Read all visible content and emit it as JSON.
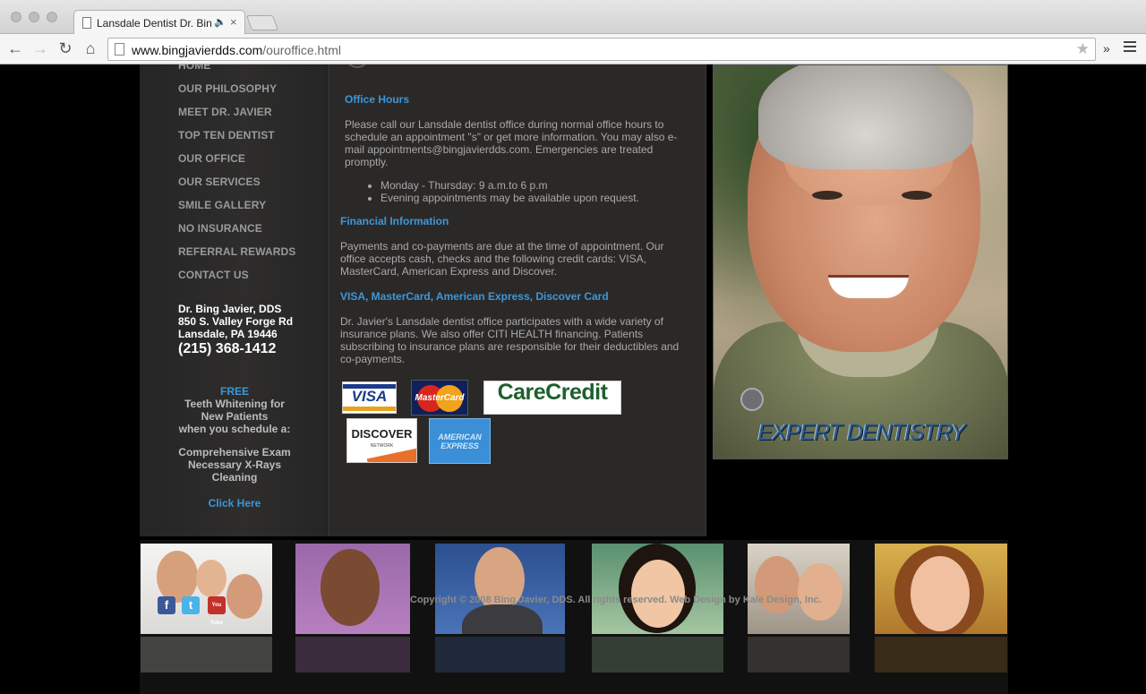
{
  "browser": {
    "tab_title": "Lansdale Dentist Dr. Bin",
    "url_host": "www.bingjavierdds.com",
    "url_path": "/ouroffice.html",
    "extensions_label": "»"
  },
  "sidebar": {
    "nav": [
      {
        "label": "HOME"
      },
      {
        "label": "OUR PHILOSOPHY"
      },
      {
        "label": "MEET DR. JAVIER"
      },
      {
        "label": "TOP TEN DENTIST"
      },
      {
        "label": "OUR OFFICE"
      },
      {
        "label": "OUR SERVICES"
      },
      {
        "label": "SMILE GALLERY"
      },
      {
        "label": "NO INSURANCE"
      },
      {
        "label": "REFERRAL REWARDS"
      },
      {
        "label": "CONTACT US"
      }
    ],
    "address": {
      "name": "Dr. Bing Javier, DDS",
      "street": "850 S. Valley Forge Rd",
      "city": "Lansdale, PA 19446",
      "phone": "(215) 368-1412"
    },
    "promo": {
      "free": "FREE",
      "line1": "Teeth Whitening for",
      "line2": "New Patients",
      "line3": "when you schedule a:",
      "item1": "Comprehensive Exam",
      "item2": "Necessary X-Rays",
      "item3": "Cleaning",
      "cta": "Click Here"
    }
  },
  "content": {
    "office_hours_heading": "Office Hours",
    "office_hours_text": "Please call our Lansdale dentist office during normal office hours to schedule an appointment \"s\" or get more information. You may also e-mail appointments@bingjavierdds.com. Emergencies are treated promptly.",
    "hours": [
      "Monday - Thursday: 9 a.m.to 6 p.m",
      "Evening appointments may be available upon request."
    ],
    "financial_heading": "Financial Information",
    "financial_text": "Payments and co-payments are due at the time of appointment. Our office accepts cash, checks and the following credit cards: VISA, MasterCard, American Express and Discover.",
    "cards_heading": "VISA, MasterCard, American Express, Discover Card",
    "insurance_text": "Dr. Javier's Lansdale dentist office participates with a wide variety of insurance plans. We also offer CITI HEALTH financing. Patients subscribing to insurance plans are responsible for their deductibles and co-payments.",
    "cards": {
      "visa": "VISA",
      "mastercard": "MasterCard",
      "carecredit": "CareCredit",
      "discover": "DISCOVER",
      "discover_sub": "NETWORK",
      "amex_1": "AMERICAN",
      "amex_2": "EXPRESS"
    }
  },
  "hero": {
    "caption": "EXPERT DENTISTRY"
  },
  "footer": {
    "copyright": "Copyright © 2008 Bing Javier, DDS. All rights reserved. Web Design by Kale Design, Inc.",
    "social": {
      "facebook": "f",
      "twitter": "t",
      "youtube": "You Tube"
    }
  },
  "colors": {
    "accent_blue": "#3d97d8",
    "nav_gray": "#9a9a9a",
    "panel_dark": "#2b2928"
  }
}
